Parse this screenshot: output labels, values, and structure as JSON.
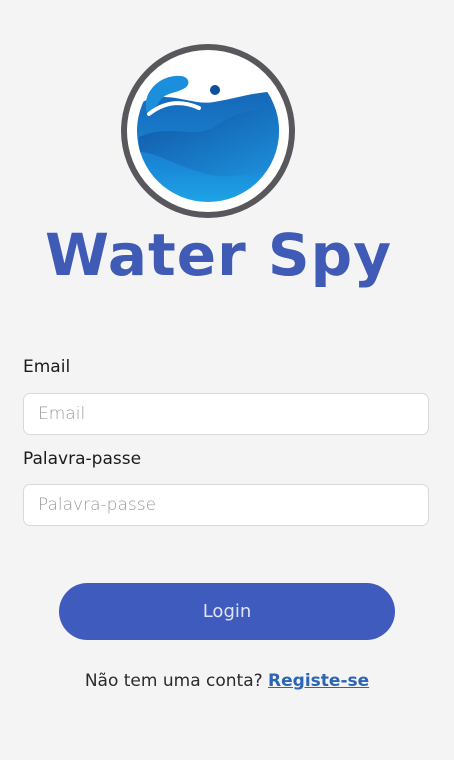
{
  "app": {
    "brand_name": "Water Spy"
  },
  "form": {
    "email_label": "Email",
    "email_placeholder": "Email",
    "email_value": "",
    "password_label": "Palavra-passe",
    "password_placeholder": "Palavra-passe",
    "password_value": "",
    "login_label": "Login"
  },
  "footer": {
    "question": "Não tem uma conta?",
    "register_link": "Registe-se"
  },
  "colors": {
    "background": "#f4f4f5",
    "brand": "#3f5bb6",
    "button": "#3e5bbd",
    "link": "#2c65b6",
    "logo_ring": "#58585c",
    "water_light": "#1aa9ea",
    "water_dark": "#0d4f9e"
  },
  "icons": {
    "logo": "water-drop-wave-logo-icon"
  }
}
